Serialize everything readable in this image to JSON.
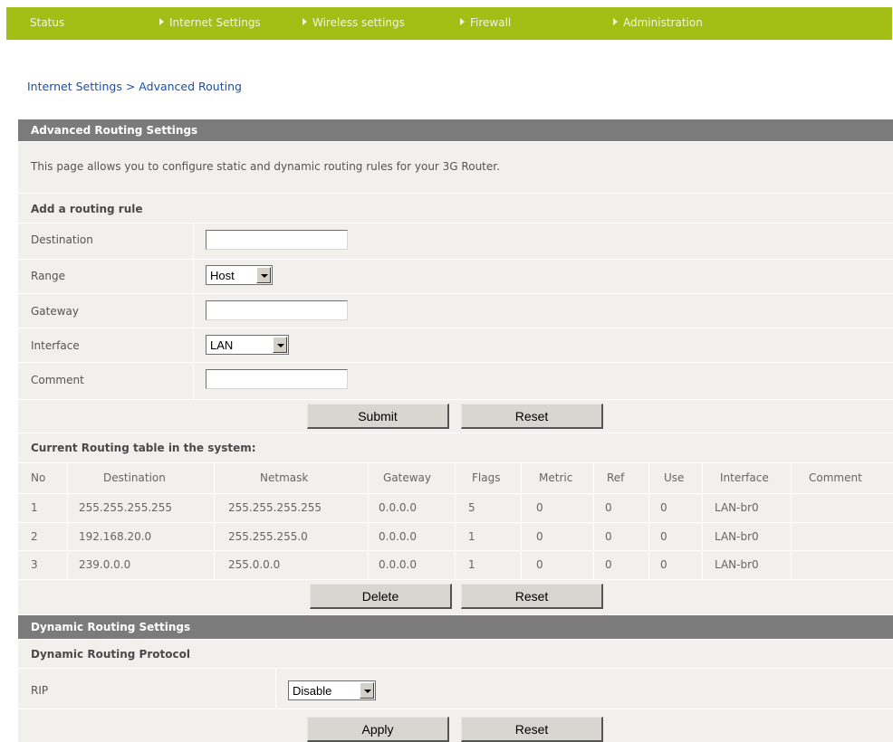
{
  "nav": {
    "status": "Status",
    "internet_settings": "Internet Settings",
    "wireless_settings": "Wireless settings",
    "firewall": "Firewall",
    "administration": "Administration"
  },
  "breadcrumb": "Internet Settings > Advanced Routing",
  "advanced": {
    "title": "Advanced Routing Settings",
    "description": "This page allows you to configure static and dynamic routing rules for your 3G Router.",
    "add_rule_title": "Add a routing rule",
    "labels": {
      "destination": "Destination",
      "range": "Range",
      "gateway": "Gateway",
      "interface": "Interface",
      "comment": "Comment"
    },
    "values": {
      "destination": "",
      "range": "Host",
      "gateway": "",
      "interface": "LAN",
      "comment": ""
    },
    "submit_label": "Submit",
    "reset_label": "Reset"
  },
  "routing_table": {
    "title": "Current Routing table in the system:",
    "columns": [
      "No",
      "Destination",
      "Netmask",
      "Gateway",
      "Flags",
      "Metric",
      "Ref",
      "Use",
      "Interface",
      "Comment"
    ],
    "rows": [
      [
        "1",
        "255.255.255.255",
        "255.255.255.255",
        "0.0.0.0",
        "5",
        "0",
        "0",
        "0",
        "LAN-br0",
        ""
      ],
      [
        "2",
        "192.168.20.0",
        "255.255.255.0",
        "0.0.0.0",
        "1",
        "0",
        "0",
        "0",
        "LAN-br0",
        ""
      ],
      [
        "3",
        "239.0.0.0",
        "255.0.0.0",
        "0.0.0.0",
        "1",
        "0",
        "0",
        "0",
        "LAN-br0",
        ""
      ]
    ],
    "delete_label": "Delete",
    "reset_label": "Reset"
  },
  "dynamic": {
    "title": "Dynamic Routing Settings",
    "protocol_title": "Dynamic Routing Protocol",
    "rip_label": "RIP",
    "rip_value": "Disable",
    "apply_label": "Apply",
    "reset_label": "Reset"
  },
  "colors": {
    "nav_bg": "#a3bf16",
    "section_header": "#7b7b7b",
    "panel_bg": "#f1f0ec",
    "link": "#1a4fa3"
  }
}
